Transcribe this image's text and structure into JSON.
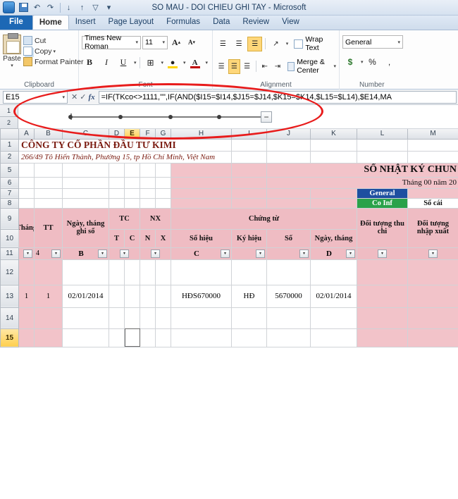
{
  "window": {
    "title": "SO MAU - DOI CHIEU GHI TAY - Microsoft"
  },
  "quick_access": {
    "items": [
      {
        "name": "save",
        "icon": "save-icon"
      },
      {
        "name": "undo",
        "icon": "undo-icon",
        "glyph": "↶"
      },
      {
        "name": "redo",
        "icon": "redo-icon",
        "glyph": "↷"
      },
      {
        "name": "sort-az",
        "icon": "sort-az-icon",
        "glyph": "↓"
      },
      {
        "name": "sort-za",
        "icon": "sort-za-icon",
        "glyph": "↑"
      },
      {
        "name": "filter",
        "icon": "filter-icon",
        "glyph": "▽"
      },
      {
        "name": "customize",
        "icon": "chevron-down-icon",
        "glyph": "▾"
      }
    ]
  },
  "ribbon": {
    "tabs": [
      {
        "label": "File",
        "active": false,
        "kind": "file"
      },
      {
        "label": "Home",
        "active": true
      },
      {
        "label": "Insert",
        "active": false
      },
      {
        "label": "Page Layout",
        "active": false
      },
      {
        "label": "Formulas",
        "active": false
      },
      {
        "label": "Data",
        "active": false
      },
      {
        "label": "Review",
        "active": false
      },
      {
        "label": "View",
        "active": false
      }
    ],
    "groups": {
      "clipboard": {
        "label": "Clipboard",
        "paste": "Paste",
        "cut": "Cut",
        "copy": "Copy",
        "format_painter": "Format Painter"
      },
      "font": {
        "label": "Font",
        "font_name": "Times New Roman",
        "font_size": "11",
        "grow": "A",
        "shrink": "A",
        "bold": "B",
        "italic": "I",
        "underline": "U",
        "borders": "⊞",
        "fill_color": "A",
        "font_color": "A",
        "fill_color_hex": "#ffd400",
        "font_color_hex": "#c00000"
      },
      "alignment": {
        "label": "Alignment",
        "wrap_text": "Wrap Text",
        "merge_center": "Merge & Center"
      },
      "number": {
        "label": "Number",
        "format": "General",
        "currency": "$",
        "percent": "%",
        "comma": ","
      }
    }
  },
  "formula_bar": {
    "name_box": "E15",
    "cancel": "✕",
    "enter": "✓",
    "fx": "fx",
    "formula": "=IF(TKco<>1111,\"\",IF(AND($I15=$I14,$J15=$J14,$K15=$K14,$L15=$L14),$E14,MA"
  },
  "slider_strip": {
    "row_labels": [
      "1",
      "2"
    ],
    "dots": [
      0,
      1,
      2,
      3,
      4
    ],
    "minus_label": "−"
  },
  "sheet": {
    "column_headers": [
      "A",
      "B",
      "C",
      "D",
      "E",
      "F",
      "G",
      "H",
      "I",
      "J",
      "K",
      "L",
      "M"
    ],
    "selected_column": "E",
    "row_headers": [
      "1",
      "2",
      "5",
      "6",
      "7",
      "8",
      "9",
      "10",
      "11",
      "12",
      "13",
      "14",
      "15"
    ],
    "selected_row": "15",
    "titles": {
      "company": "CÔNG TY CỔ PHẦN ĐẦU TƯ KIMI",
      "address": "266/49 Tô Hiến Thành, Phường 15, tp Hồ Chí Minh, Việt Nam",
      "book_title": "SỔ NHẬT KÝ CHUN",
      "period": "Tháng 00 năm 20"
    },
    "banner": {
      "general": "General",
      "co_inf": "Co Inf",
      "so_cai": "Sổ cái"
    },
    "headers": {
      "thang": "Tháng",
      "tt": "TT",
      "ngay_thang_ghi_so": "Ngày, tháng ghi sổ",
      "tc": "TC",
      "nx": "NX",
      "tc_t": "T",
      "tc_c": "C",
      "nx_n": "N",
      "nx_x": "X",
      "chung_tu": "Chứng từ",
      "so_hieu": "Số hiệu",
      "ky_hieu": "Ký hiệu",
      "so": "Số",
      "ngay_thang": "Ngày, tháng",
      "doi_tuong_thu_chi": "Đối tượng thu chi",
      "doi_tuong_nhap_xuat": "Đối tượng nhập xuất"
    },
    "filter_row": {
      "b": "B",
      "c": "C",
      "d": "D",
      "tt_mark": "4"
    },
    "data_row": {
      "thang": "1",
      "tt": "1",
      "ngay_ghi_so": "02/01/2014",
      "so_hieu": "HĐS670000",
      "ky_hieu": "HĐ",
      "so": "5670000",
      "ngay_thang": "02/01/2014"
    }
  }
}
